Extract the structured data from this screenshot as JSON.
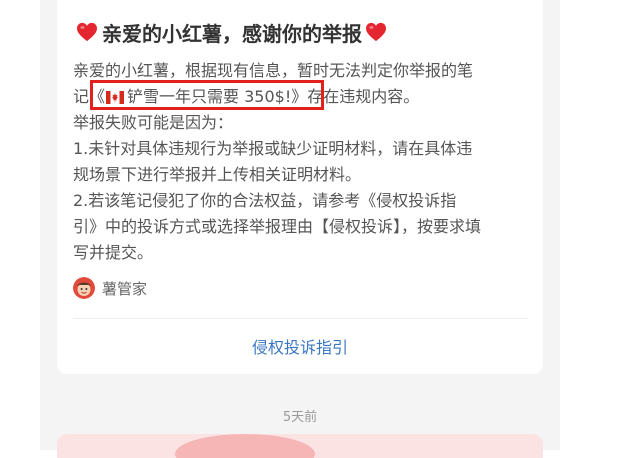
{
  "message": {
    "title": "亲爱的小红薯，感谢你的举报",
    "body": {
      "line1": "亲爱的小红薯，根据现有信息，暂时无法判定你举报的笔",
      "line2_prefix": "记",
      "note_ref_open": "《",
      "note_ref_title": "铲雪一年只需要 350$!",
      "note_ref_close": "》",
      "line2_suffix": "存在违规内容。",
      "line3": "举报失败可能是因为：",
      "line4": "1.未针对具体违规行为举报或缺少证明材料，请在具体违",
      "line5": "规场景下进行举报并上传相关证明材料。",
      "line6": "2.若该笔记侵犯了你的合法权益，请参考《侵权投诉指",
      "line7": "引》中的投诉方式或选择举报理由【侵权投诉】，按要求填",
      "line8": "写并提交。"
    },
    "sender": "薯管家",
    "action_link": "侵权投诉指引",
    "timestamp": "5天前"
  },
  "icons": {
    "title_left": "red-heart-icon",
    "title_right": "red-heart-icon",
    "flag": "canada-flag-icon",
    "avatar": "sender-avatar"
  },
  "colors": {
    "highlight_box": "#e2211c",
    "heart": "#e3262f",
    "link": "#3b78c2",
    "background": "#f4f4f4",
    "card": "#ffffff"
  }
}
